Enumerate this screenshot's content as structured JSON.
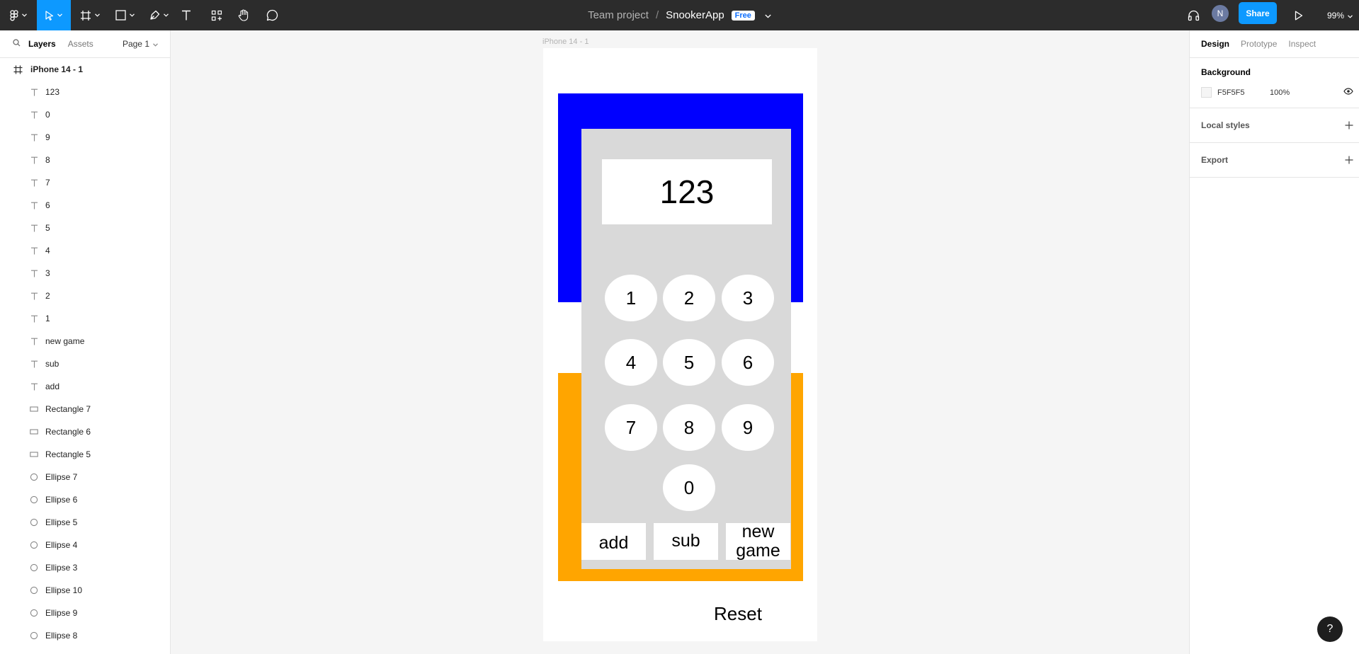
{
  "toolbar": {
    "breadcrumb_team": "Team project",
    "breadcrumb_sep": "/",
    "file_name": "SnookerApp",
    "plan_badge": "Free",
    "avatar_initial": "N",
    "share_label": "Share",
    "zoom": "99%"
  },
  "left_panel": {
    "tabs": [
      "Layers",
      "Assets"
    ],
    "page": "Page 1",
    "layers": [
      {
        "name": "iPhone 14 - 1",
        "type": "frame"
      },
      {
        "name": "123",
        "type": "text"
      },
      {
        "name": "0",
        "type": "text"
      },
      {
        "name": "9",
        "type": "text"
      },
      {
        "name": "8",
        "type": "text"
      },
      {
        "name": "7",
        "type": "text"
      },
      {
        "name": "6",
        "type": "text"
      },
      {
        "name": "5",
        "type": "text"
      },
      {
        "name": "4",
        "type": "text"
      },
      {
        "name": "3",
        "type": "text"
      },
      {
        "name": "2",
        "type": "text"
      },
      {
        "name": "1",
        "type": "text"
      },
      {
        "name": "new game",
        "type": "text"
      },
      {
        "name": "sub",
        "type": "text"
      },
      {
        "name": "add",
        "type": "text"
      },
      {
        "name": "Rectangle 7",
        "type": "rectangle"
      },
      {
        "name": "Rectangle 6",
        "type": "rectangle"
      },
      {
        "name": "Rectangle 5",
        "type": "rectangle"
      },
      {
        "name": "Ellipse 7",
        "type": "ellipse"
      },
      {
        "name": "Ellipse 6",
        "type": "ellipse"
      },
      {
        "name": "Ellipse 5",
        "type": "ellipse"
      },
      {
        "name": "Ellipse 4",
        "type": "ellipse"
      },
      {
        "name": "Ellipse 3",
        "type": "ellipse"
      },
      {
        "name": "Ellipse 10",
        "type": "ellipse"
      },
      {
        "name": "Ellipse 9",
        "type": "ellipse"
      },
      {
        "name": "Ellipse 8",
        "type": "ellipse"
      }
    ]
  },
  "right_panel": {
    "tabs": [
      "Design",
      "Prototype",
      "Inspect"
    ],
    "background_title": "Background",
    "background_hex": "F5F5F5",
    "background_opacity": "100%",
    "local_styles": "Local styles",
    "export": "Export"
  },
  "canvas": {
    "frame_label": "iPhone 14 - 1",
    "display_value": "123",
    "keys": [
      "1",
      "2",
      "3",
      "4",
      "5",
      "6",
      "7",
      "8",
      "9",
      "0"
    ],
    "add_label": "add",
    "sub_label": "sub",
    "new_game_label": "new game",
    "reset_label": "Reset"
  },
  "colors": {
    "toolbar_bg": "#2c2c2c",
    "accent": "#0d99ff",
    "blue_rect": "#0000ff",
    "orange_rect": "#ffa500",
    "gray_rect": "#d9d9d9",
    "canvas_bg": "#f5f5f5"
  },
  "help_label": "?"
}
